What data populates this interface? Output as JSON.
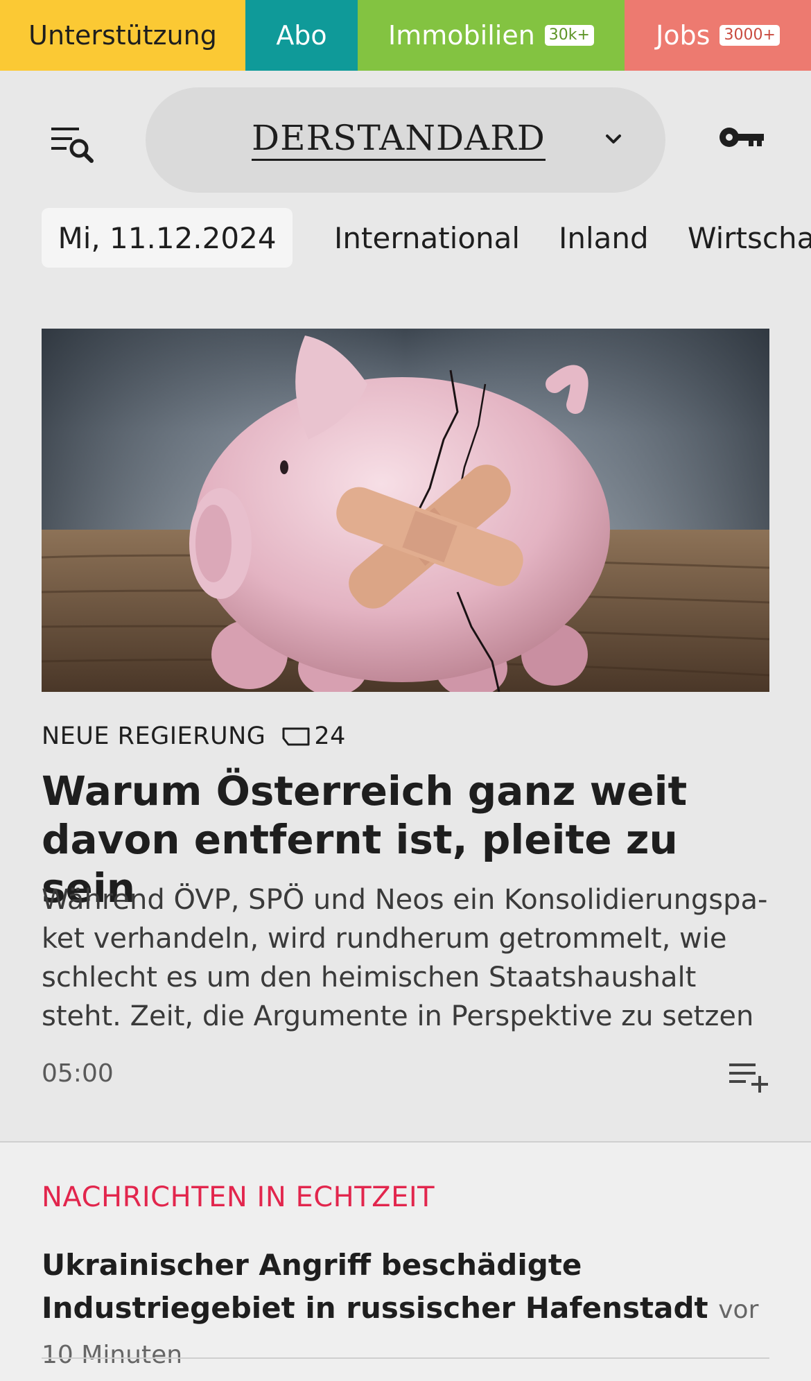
{
  "topbar": {
    "support": "Unterstützung",
    "abo": "Abo",
    "immobilien": "Immobilien",
    "immobilien_badge": "30k+",
    "jobs": "Jobs",
    "jobs_badge": "3000+"
  },
  "header": {
    "brand": "DERSTANDARD"
  },
  "nav": {
    "date": "Mi, 11.12.2024",
    "items": [
      "International",
      "Inland",
      "Wirtscha"
    ]
  },
  "article": {
    "kicker": "NEUE REGIERUNG",
    "comments": "24",
    "headline": "Warum Österreich ganz weit davon entfernt ist, pleite zu sein",
    "teaser": "Während ÖVP, SPÖ und Neos ein Konsolidierungspa­ket verhandeln, wird rundherum getrommelt, wie schlecht es um den heimischen Staatshaushalt steht. Zeit, die Argumente in Perspektive zu setzen",
    "time": "05:00"
  },
  "live": {
    "title": "NACHRICHTEN IN ECHTZEIT",
    "headline": "Ukrainischer Angriff beschädigte Industriegebiet in russischer Hafenstadt",
    "time": "vor 10 Minuten"
  },
  "colors": {
    "support": "#fbc934",
    "abo": "#0f9a99",
    "immobilien": "#83c341",
    "jobs": "#ed7a70",
    "live_accent": "#e2264d"
  },
  "icons": [
    "menu-search-icon",
    "chevron-down-icon",
    "key-icon",
    "comment-icon",
    "playlist-add-icon"
  ]
}
